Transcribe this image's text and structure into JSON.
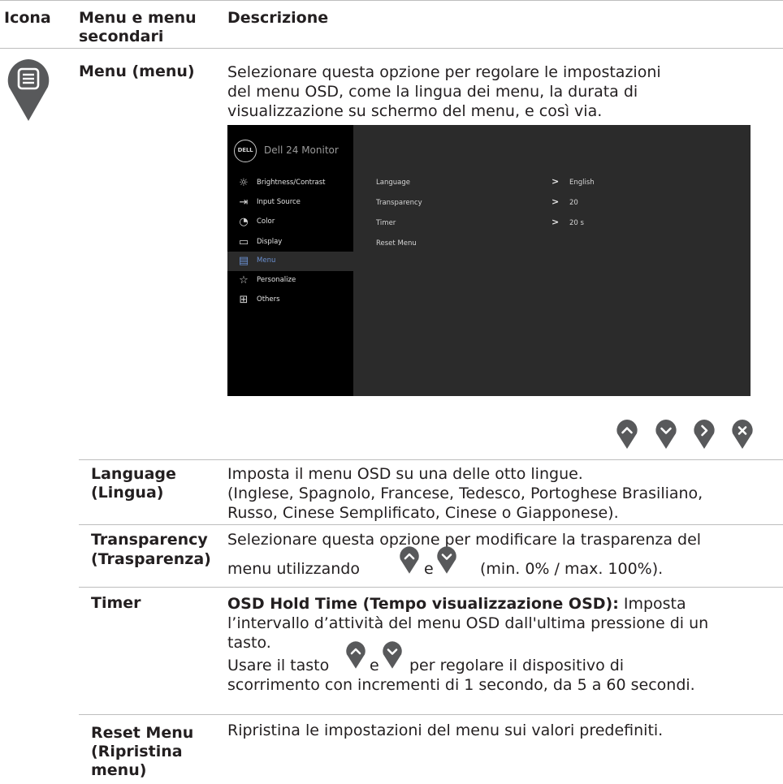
{
  "header": {
    "col1": "Icona",
    "col2_line1": "Menu e menu",
    "col2_line2": "secondari",
    "col3": "Descrizione"
  },
  "menu_row": {
    "icon": "menu-list-icon",
    "name": "Menu (menu)",
    "desc_line1": "Selezionare questa opzione per regolare le impostazioni",
    "desc_line2": "del menu OSD, come la lingua dei menu, la durata di",
    "desc_line3": "visualizzazione su schermo del menu, e così via."
  },
  "osd": {
    "brand": "DELL",
    "title": "Dell 24 Monitor",
    "menu_items": [
      {
        "label": "Brightness/Contrast",
        "icon": "sun-icon"
      },
      {
        "label": "Input Source",
        "icon": "input-icon"
      },
      {
        "label": "Color",
        "icon": "palette-icon"
      },
      {
        "label": "Display",
        "icon": "display-icon"
      },
      {
        "label": "Menu",
        "icon": "menu-icon",
        "selected": true
      },
      {
        "label": "Personalize",
        "icon": "star-icon"
      },
      {
        "label": "Others",
        "icon": "sliders-icon"
      }
    ],
    "options": [
      {
        "label": "Language",
        "value": "English"
      },
      {
        "label": "Transparency",
        "value": "20"
      },
      {
        "label": "Timer",
        "value": "20 s"
      },
      {
        "label": "Reset Menu",
        "value": ""
      }
    ],
    "accent_color": "#6a8fd0"
  },
  "nav_buttons": [
    "up-icon",
    "down-icon",
    "right-icon",
    "close-icon"
  ],
  "rows": {
    "language": {
      "name_line1": "Language",
      "name_line2": "(Lingua)",
      "desc_line1": "Imposta il menu OSD su una delle otto lingue.",
      "desc_line2": "(Inglese, Spagnolo, Francese, Tedesco, Portoghese Brasiliano,",
      "desc_line3": "Russo, Cinese Semplificato, Cinese o Giapponese)."
    },
    "transparency": {
      "name_line1": "Transparency",
      "name_line2": "(Trasparenza)",
      "desc_line1": "Selezionare questa opzione per modificare la trasparenza del",
      "desc_line2a": "menu utilizzando",
      "desc_line2b": "e",
      "desc_line2c": "(min. 0% / max. 100%)."
    },
    "timer": {
      "name": "Timer",
      "desc_bold": "OSD Hold Time (Tempo visualizzazione OSD):",
      "desc_line1_rest": " Imposta",
      "desc_line2": "l’intervallo d’attività del menu OSD dall'ultima pressione di un",
      "desc_line3": "tasto.",
      "desc_line4a": "Usare il tasto",
      "desc_line4b": "e",
      "desc_line4c": "per regolare il dispositivo di",
      "desc_line5": "scorrimento con incrementi di 1 secondo, da 5 a 60 secondi."
    },
    "reset": {
      "name_line1": "Reset Menu",
      "name_line2": "(Ripristina",
      "name_line3": "menu)",
      "desc": "Ripristina le impostazioni del menu sui valori predefiniti."
    }
  },
  "colors": {
    "pin": "#58595b",
    "text": "#231f20"
  }
}
